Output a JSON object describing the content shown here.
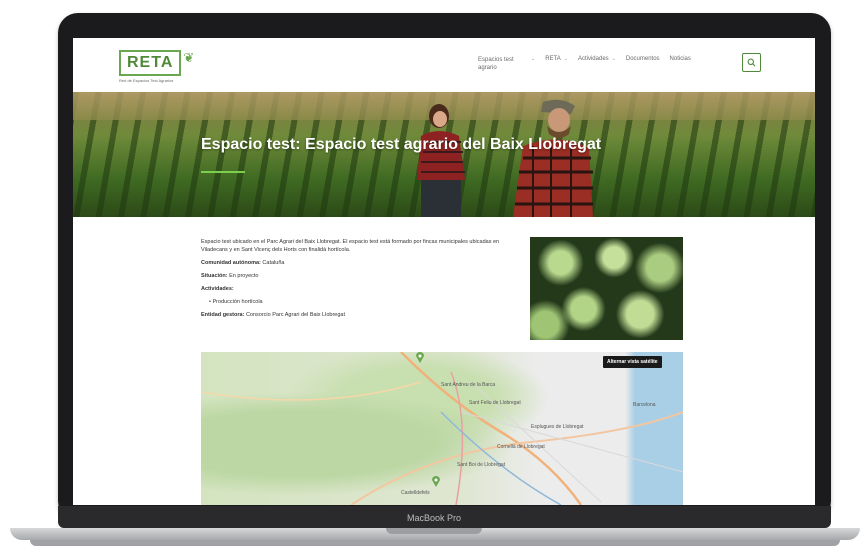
{
  "device": {
    "label": "MacBook Pro"
  },
  "header": {
    "logo_text": "RETA",
    "logo_subtitle": "Red de Espacios Test Agrarios",
    "nav": [
      {
        "label": "Espacios test agrario",
        "has_dropdown": true
      },
      {
        "label": "RETA",
        "has_dropdown": true
      },
      {
        "label": "Actividades",
        "has_dropdown": true
      },
      {
        "label": "Documentos",
        "has_dropdown": false
      },
      {
        "label": "Noticias",
        "has_dropdown": false
      }
    ],
    "search_icon": "search-icon"
  },
  "hero": {
    "title": "Espacio test: Espacio test agrario del Baix Llobregat"
  },
  "content": {
    "description": "Espacio test ubicado en el Parc Agrari del Baix Llobregat. El espacio test está formado por fincas municipales ubicadas en Viladecans y en Sant Vicenç dels Horts con finalidá hortícola.",
    "comunidad_label": "Comunidad autónoma:",
    "comunidad_value": "Cataluña",
    "situacion_label": "Situación:",
    "situacion_value": "En proyecto",
    "actividades_label": "Actividades:",
    "actividades": [
      "Producción hortícola"
    ],
    "entidad_label": "Entidad gestora:",
    "entidad_value": "Consorcio Parc Agrari del Baix Llobregat"
  },
  "map": {
    "toggle_label": "Alternar vista satélite",
    "places": [
      "Sant Andreu de la Barca",
      "Sant Feliu de Llobregat",
      "Cornellà de Llobregat",
      "Sant Boi de Llobregat",
      "Esplugues de Llobregat",
      "Barcelona",
      "Castelldefels"
    ]
  },
  "colors": {
    "brand_green": "#4f8a3a",
    "accent_green": "#7ccf4c",
    "nav_text": "#6b6b6b"
  }
}
